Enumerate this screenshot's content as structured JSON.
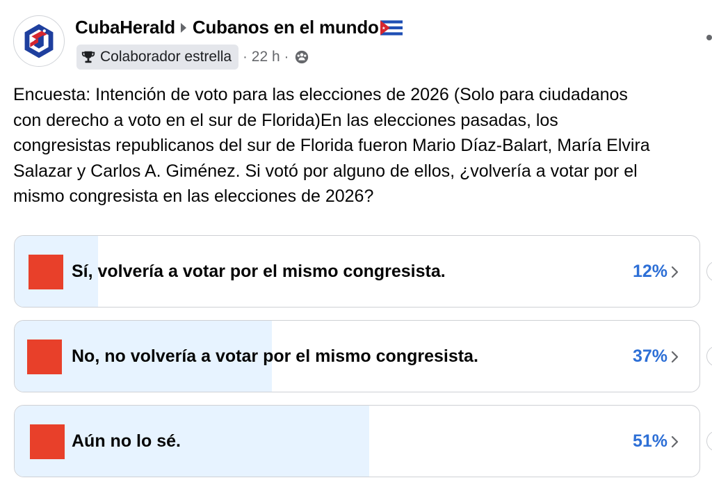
{
  "post": {
    "author": "CubaHerald",
    "group": "Cubanos en el mundo",
    "badge_label": "Colaborador estrella",
    "time": "22 h",
    "separator": "·",
    "text": "Encuesta: Intención de voto para las elecciones de 2026 (Solo para ciudadanos\ncon derecho a voto en el sur de Florida)En las elecciones pasadas, los\ncongresistas republicanos del sur de Florida fueron Mario Díaz-Balart, María Elvira\nSalazar y Carlos A. Giménez. Si votó por alguno de ellos, ¿volvería a votar por el\nmismo congresista en las elecciones de 2026?"
  },
  "poll": {
    "options": [
      {
        "label": "Sí, volvería a votar por el mismo congresista.",
        "percent_label": "12%",
        "share": 0.12
      },
      {
        "label": "No, no volvería a votar por el mismo congresista.",
        "percent_label": "37%",
        "share": 0.37
      },
      {
        "label": "Aún no lo sé.",
        "percent_label": "51%",
        "share": 0.51
      }
    ]
  },
  "colors": {
    "accent": "#2d6fd6",
    "option_square": "#e8402a",
    "result_fill": "#e7f3ff"
  },
  "icons": {
    "avatar": "cubaherald-logo",
    "separator": "caret-right-icon",
    "flag": "cuba-flag-icon",
    "badge": "trophy-icon",
    "audience": "public-group-icon",
    "option_arrow": "chevron-right-icon"
  }
}
